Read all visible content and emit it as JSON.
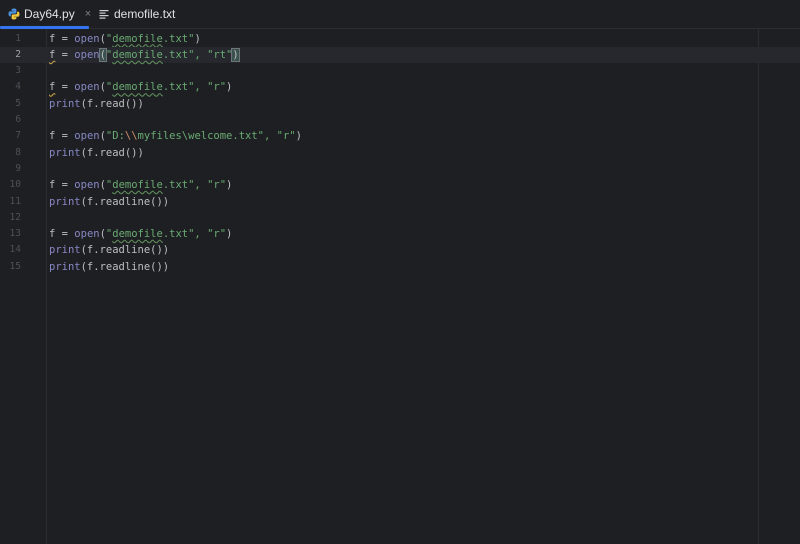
{
  "tabs": [
    {
      "label": "Day64.py",
      "icon": "python-file-icon",
      "active": true,
      "close": "×"
    },
    {
      "label": "demofile.txt",
      "icon": "text-file-icon",
      "active": false
    }
  ],
  "editor": {
    "current_line": 2,
    "lines": [
      {
        "number": "1",
        "tokens": [
          [
            "f",
            "var"
          ],
          [
            " = ",
            "plain"
          ],
          [
            "open",
            "builtin"
          ],
          [
            "(",
            "plain"
          ],
          [
            "\"",
            "str"
          ],
          [
            "demofile",
            "str-typo"
          ],
          [
            ".txt\"",
            "str"
          ],
          [
            ")",
            "plain"
          ]
        ]
      },
      {
        "number": "2",
        "tokens": [
          [
            "f",
            "var-warn"
          ],
          [
            " = ",
            "plain"
          ],
          [
            "open",
            "builtin"
          ],
          [
            "(",
            "bracket"
          ],
          [
            "\"",
            "str"
          ],
          [
            "demofile",
            "str-typo"
          ],
          [
            ".txt\", \"rt\"",
            "str"
          ],
          [
            ")",
            "bracket"
          ]
        ]
      },
      {
        "number": "3",
        "tokens": []
      },
      {
        "number": "4",
        "tokens": [
          [
            "f",
            "var-warn"
          ],
          [
            " = ",
            "plain"
          ],
          [
            "open",
            "builtin"
          ],
          [
            "(",
            "plain"
          ],
          [
            "\"",
            "str"
          ],
          [
            "demofile",
            "str-typo"
          ],
          [
            ".txt\", \"r\"",
            "str"
          ],
          [
            ")",
            "plain"
          ]
        ]
      },
      {
        "number": "5",
        "tokens": [
          [
            "print",
            "builtin"
          ],
          [
            "(f.read())",
            "plain"
          ]
        ]
      },
      {
        "number": "6",
        "tokens": []
      },
      {
        "number": "7",
        "tokens": [
          [
            "f",
            "var"
          ],
          [
            " = ",
            "plain"
          ],
          [
            "open",
            "builtin"
          ],
          [
            "(",
            "plain"
          ],
          [
            "\"D:",
            "str"
          ],
          [
            "\\\\",
            "esc"
          ],
          [
            "myfiles\\welcome.txt\", \"r\"",
            "str"
          ],
          [
            ")",
            "plain"
          ]
        ]
      },
      {
        "number": "8",
        "tokens": [
          [
            "print",
            "builtin"
          ],
          [
            "(f.read())",
            "plain"
          ]
        ]
      },
      {
        "number": "9",
        "tokens": []
      },
      {
        "number": "10",
        "tokens": [
          [
            "f",
            "var"
          ],
          [
            " = ",
            "plain"
          ],
          [
            "open",
            "builtin"
          ],
          [
            "(",
            "plain"
          ],
          [
            "\"",
            "str"
          ],
          [
            "demofile",
            "str-typo"
          ],
          [
            ".txt\", \"r\"",
            "str"
          ],
          [
            ")",
            "plain"
          ]
        ]
      },
      {
        "number": "11",
        "tokens": [
          [
            "print",
            "builtin"
          ],
          [
            "(f.readline())",
            "plain"
          ]
        ]
      },
      {
        "number": "12",
        "tokens": []
      },
      {
        "number": "13",
        "tokens": [
          [
            "f",
            "var"
          ],
          [
            " = ",
            "plain"
          ],
          [
            "open",
            "builtin"
          ],
          [
            "(",
            "plain"
          ],
          [
            "\"",
            "str"
          ],
          [
            "demofile",
            "str-typo"
          ],
          [
            ".txt\", \"r\"",
            "str"
          ],
          [
            ")",
            "plain"
          ]
        ]
      },
      {
        "number": "14",
        "tokens": [
          [
            "print",
            "builtin"
          ],
          [
            "(f.readline())",
            "plain"
          ]
        ]
      },
      {
        "number": "15",
        "tokens": [
          [
            "print",
            "builtin"
          ],
          [
            "(f.readline())",
            "plain"
          ]
        ]
      }
    ]
  },
  "colors": {
    "background": "#1e1f22",
    "accent": "#3574f0",
    "string": "#6aab73",
    "builtin": "#8888c6",
    "escape": "#cf8e6d"
  }
}
